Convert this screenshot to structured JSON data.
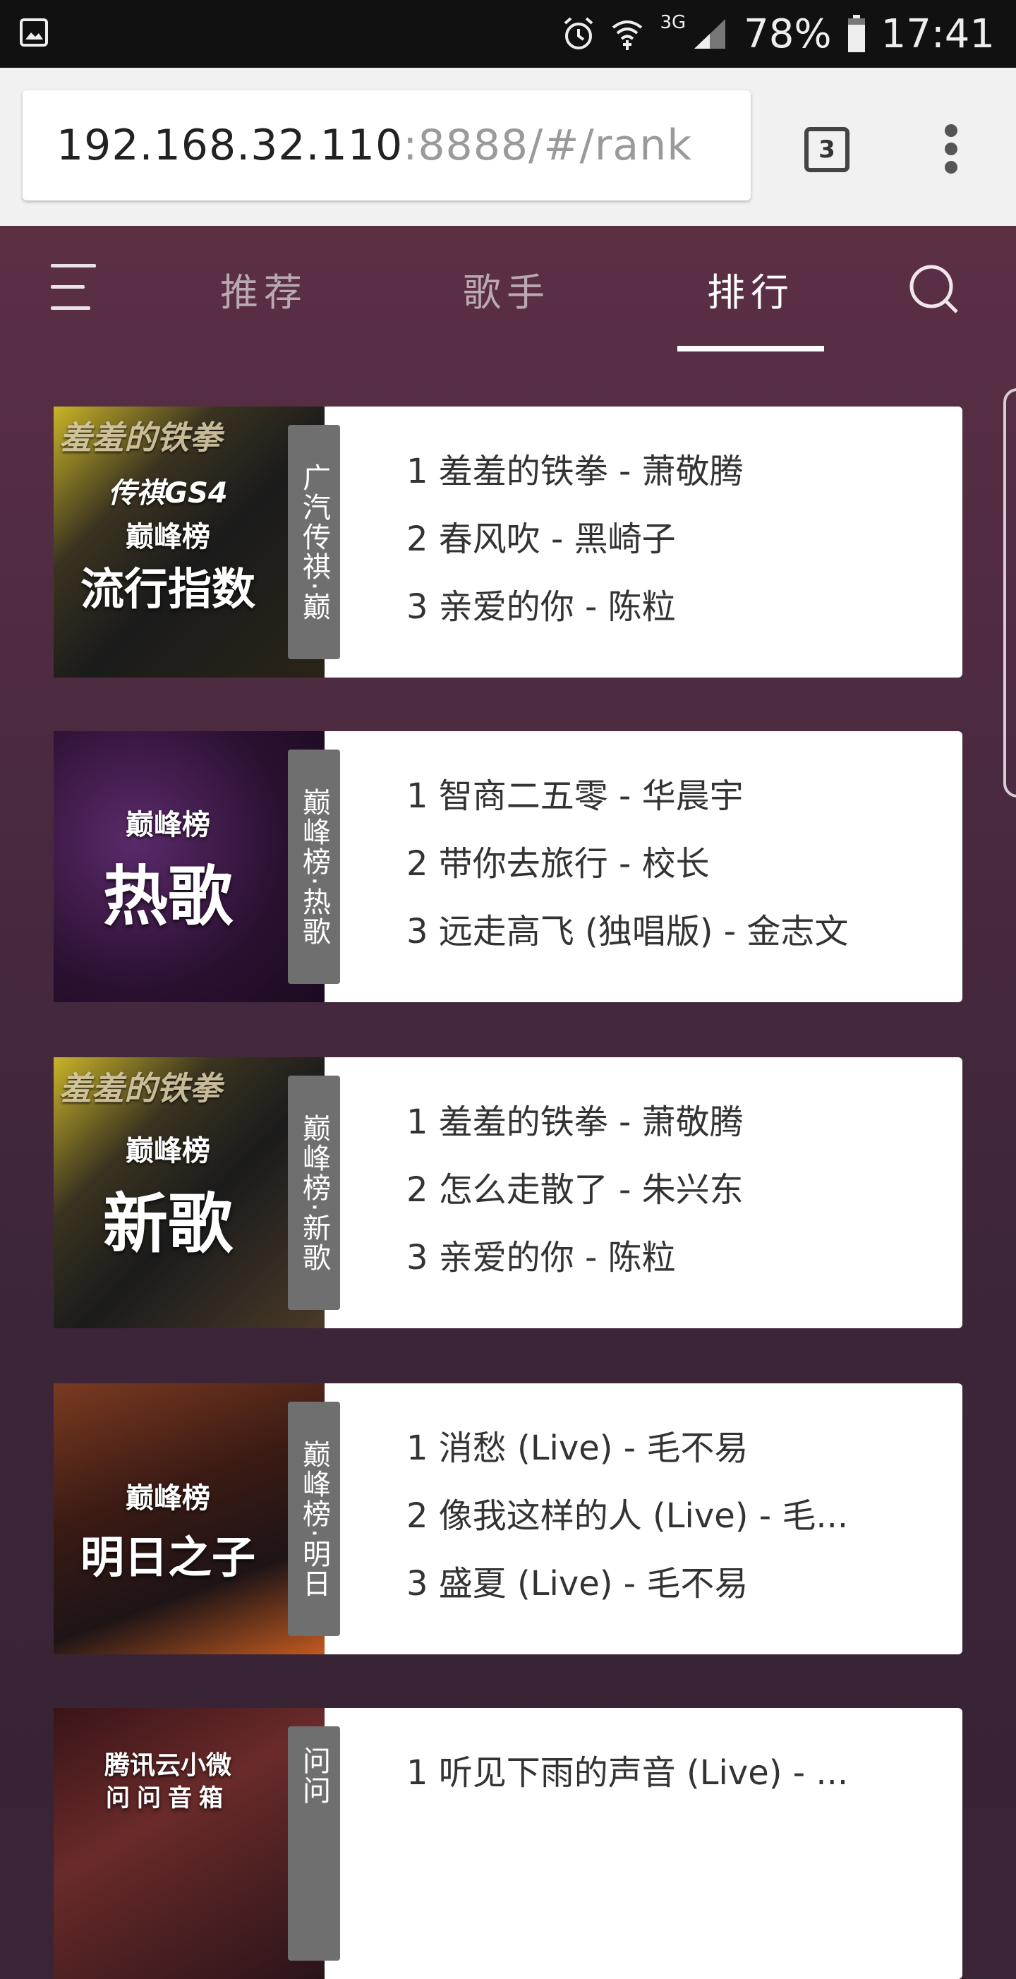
{
  "status_bar": {
    "battery": "78%",
    "time": "17:41",
    "network": "3G",
    "icons": [
      "image-icon",
      "alarm-icon",
      "wifi-icon",
      "signal-icon",
      "battery-icon"
    ]
  },
  "browser": {
    "url_host": "192.168.32.110",
    "url_path": ":8888/#/rank",
    "tab_count": "3"
  },
  "nav": {
    "tabs": [
      {
        "label": "推荐"
      },
      {
        "label": "歌手"
      },
      {
        "label": "排行"
      }
    ],
    "active_tab": "排行"
  },
  "ranks": [
    {
      "tag": "广汽传祺·巅",
      "cover_top": "羞羞的铁拳",
      "cover_brand": "传祺GS4",
      "cover_title": "流行指数",
      "songs": [
        "1 羞羞的铁拳 - 萧敬腾",
        "2 春风吹 - 黑崎子",
        "3 亲爱的你 - 陈粒"
      ]
    },
    {
      "tag": "巅峰榜·热歌",
      "cover_top": "",
      "cover_brand": "",
      "cover_title": "热歌",
      "songs": [
        "1 智商二五零 - 华晨宇",
        "2 带你去旅行 - 校长",
        "3 远走高飞 (独唱版) - 金志文"
      ]
    },
    {
      "tag": "巅峰榜·新歌",
      "cover_top": "羞羞的铁拳",
      "cover_brand": "",
      "cover_title": "新歌",
      "songs": [
        "1 羞羞的铁拳 - 萧敬腾",
        "2 怎么走散了 - 朱兴东",
        "3 亲爱的你 - 陈粒"
      ]
    },
    {
      "tag": "巅峰榜·明日",
      "cover_top": "",
      "cover_brand": "",
      "cover_title": "明日之子",
      "songs": [
        "1 消愁 (Live) - 毛不易",
        "2 像我这样的人 (Live) - 毛...",
        "3 盛夏 (Live) - 毛不易"
      ]
    },
    {
      "tag": "问问",
      "cover_top": "",
      "cover_brand": "腾讯云小微",
      "cover_title": "问问音箱",
      "songs": [
        "1 听见下雨的声音 (Live) - ..."
      ]
    }
  ],
  "colors": {
    "app_bg_top": "#5c2f45",
    "app_bg_bottom": "#382336",
    "tab_active": "#ffffff",
    "tab_inactive": "#b9a9b4",
    "label_bg": "#6f6f6f"
  }
}
